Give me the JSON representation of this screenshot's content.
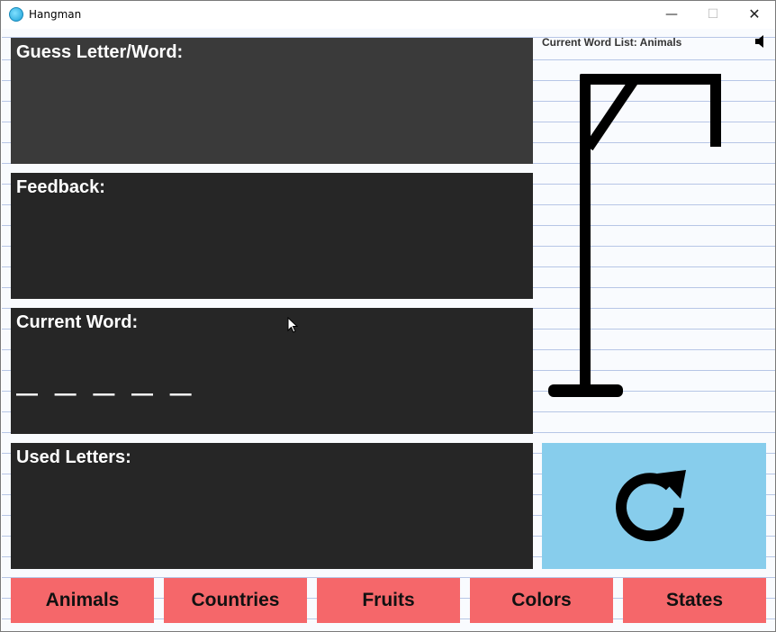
{
  "window": {
    "title": "Hangman",
    "controls": {
      "minimize": "—",
      "maximize": "☐",
      "close": "✕"
    }
  },
  "panels": {
    "guess_label": "Guess Letter/Word:",
    "feedback_label": "Feedback:",
    "current_word_label": "Current Word:",
    "current_word_slots": "— — — — —",
    "used_letters_label": "Used Letters:"
  },
  "word_list": {
    "label": "Current Word List: Animals"
  },
  "categories": [
    "Animals",
    "Countries",
    "Fruits",
    "Colors",
    "States"
  ],
  "icons": {
    "speaker": "speaker-icon",
    "reset": "refresh-icon",
    "app": "app-icon"
  },
  "colors": {
    "panel_bg": "#262626",
    "guess_panel_bg": "#3a3a3a",
    "category_button": "#f5676a",
    "reset_button": "#87cdec",
    "gallows": "#000000",
    "notebook_line": "#b7c6e6"
  }
}
